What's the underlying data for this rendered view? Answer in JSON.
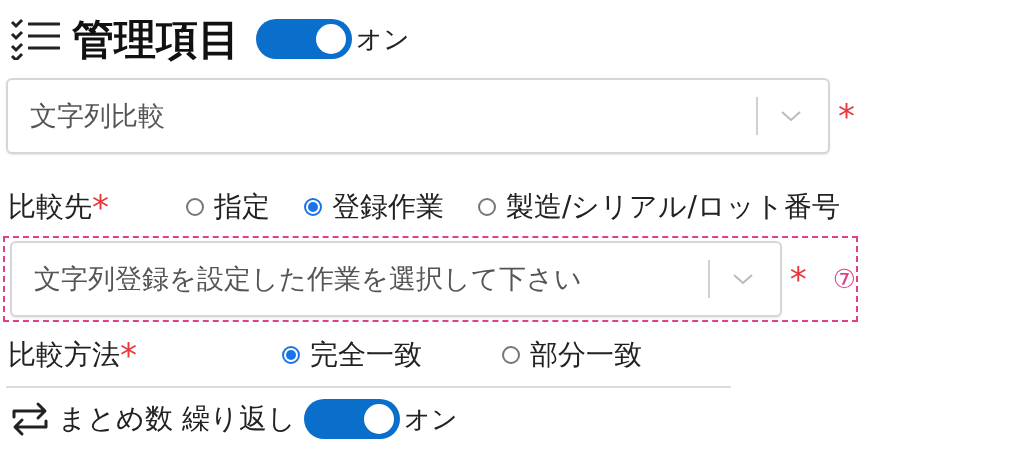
{
  "header": {
    "title": "管理項目",
    "toggle": {
      "on": true,
      "label": "オン"
    }
  },
  "item_select": {
    "value": "文字列比較",
    "required_mark": "*"
  },
  "compare_target": {
    "label": "比較先",
    "required_mark": "*",
    "options": [
      {
        "label": "指定",
        "selected": false
      },
      {
        "label": "登録作業",
        "selected": true
      },
      {
        "label": "製造/シリアル/ロット番号",
        "selected": false
      }
    ]
  },
  "target_select": {
    "placeholder": "文字列登録を設定した作業を選択して下さい",
    "required_mark": "*",
    "annotation": "⑦"
  },
  "compare_method": {
    "label": "比較方法",
    "required_mark": "*",
    "options": [
      {
        "label": "完全一致",
        "selected": true
      },
      {
        "label": "部分一致",
        "selected": false
      }
    ]
  },
  "repeat": {
    "label": "まとめ数 繰り返し",
    "toggle": {
      "on": true,
      "label": "オン"
    }
  }
}
